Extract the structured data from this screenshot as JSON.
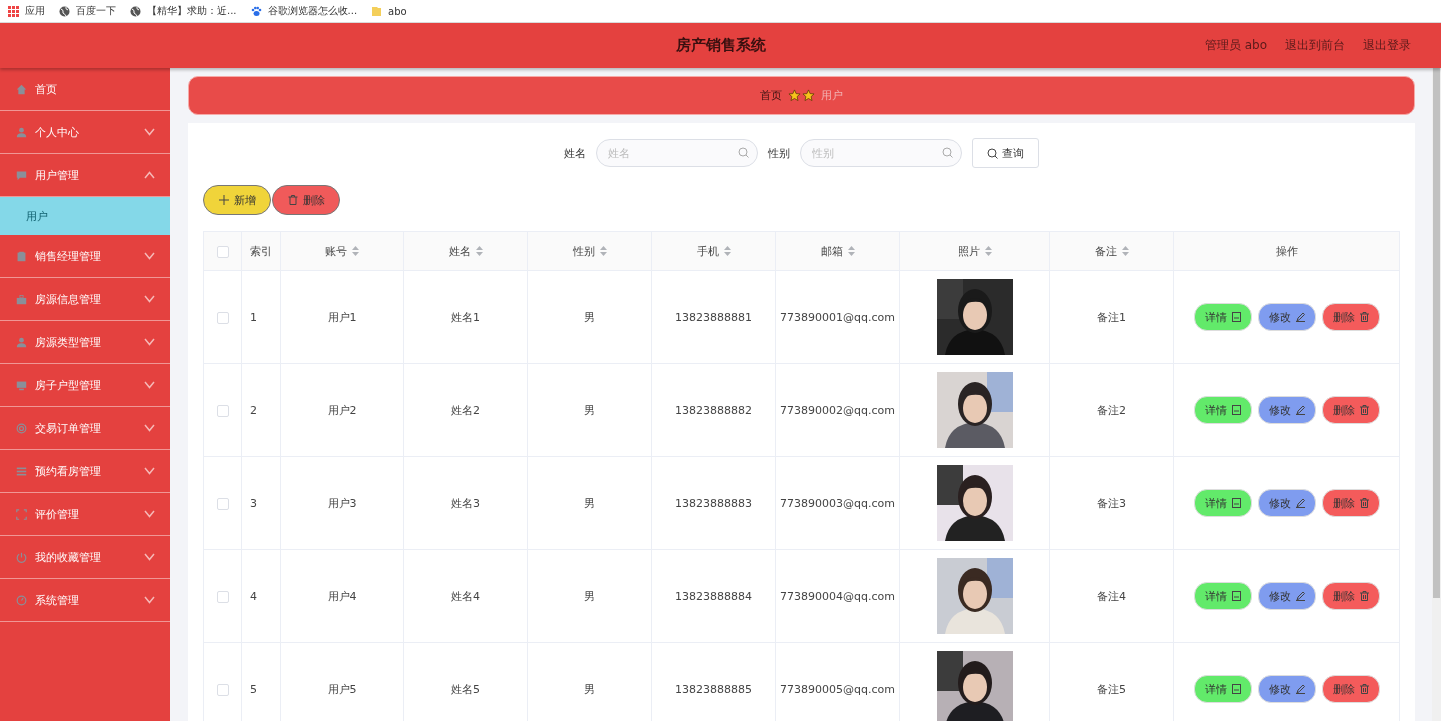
{
  "bookmarks": [
    {
      "kind": "apps",
      "label": "应用"
    },
    {
      "kind": "globe",
      "label": "百度一下"
    },
    {
      "kind": "globe",
      "label": "【精华】求助：近..."
    },
    {
      "kind": "paw",
      "label": "谷歌浏览器怎么收..."
    },
    {
      "kind": "folder",
      "label": "abo"
    }
  ],
  "header": {
    "title": "房产销售系统",
    "links": [
      "管理员 abo",
      "退出到前台",
      "退出登录"
    ]
  },
  "sidebar": {
    "items": [
      {
        "label": "首页",
        "kind": "link"
      },
      {
        "label": "个人中心",
        "kind": "menu",
        "expanded": false
      },
      {
        "label": "用户管理",
        "kind": "menu",
        "expanded": true,
        "children": [
          {
            "label": "用户",
            "selected": true
          }
        ]
      },
      {
        "label": "销售经理管理",
        "kind": "menu",
        "expanded": false
      },
      {
        "label": "房源信息管理",
        "kind": "menu",
        "expanded": false
      },
      {
        "label": "房源类型管理",
        "kind": "menu",
        "expanded": false
      },
      {
        "label": "房子户型管理",
        "kind": "menu",
        "expanded": false
      },
      {
        "label": "交易订单管理",
        "kind": "menu",
        "expanded": false
      },
      {
        "label": "预约看房管理",
        "kind": "menu",
        "expanded": false
      },
      {
        "label": "评价管理",
        "kind": "menu",
        "expanded": false
      },
      {
        "label": "我的收藏管理",
        "kind": "menu",
        "expanded": false
      },
      {
        "label": "系统管理",
        "kind": "menu",
        "expanded": false
      }
    ]
  },
  "breadcrumb": [
    {
      "label": "首页",
      "current": false
    },
    {
      "label": "用户",
      "current": true
    }
  ],
  "search": {
    "fields": [
      {
        "label": "姓名",
        "placeholder": "姓名"
      },
      {
        "label": "性别",
        "placeholder": "性别"
      }
    ],
    "button": "查询"
  },
  "actions": [
    {
      "kind": "add",
      "label": "新增"
    },
    {
      "kind": "delete",
      "label": "删除"
    }
  ],
  "table": {
    "header_checked": false,
    "columns": [
      {
        "label": "索引",
        "sortable": false
      },
      {
        "label": "账号",
        "sortable": true
      },
      {
        "label": "姓名",
        "sortable": true
      },
      {
        "label": "性别",
        "sortable": true
      },
      {
        "label": "手机",
        "sortable": true
      },
      {
        "label": "邮箱",
        "sortable": true
      },
      {
        "label": "照片",
        "sortable": true
      },
      {
        "label": "备注",
        "sortable": true
      },
      {
        "label": "操作",
        "sortable": false
      }
    ],
    "rows": [
      {
        "checked": false,
        "index": "1",
        "account": "用户1",
        "name": "姓名1",
        "gender": "男",
        "phone": "13823888881",
        "email": "773890001@qq.com",
        "note": "备注1",
        "buttons": [
          {
            "kind": "detail",
            "label": "详情"
          },
          {
            "kind": "edit",
            "label": "修改"
          },
          {
            "kind": "delete",
            "label": "删除"
          }
        ]
      },
      {
        "checked": false,
        "index": "2",
        "account": "用户2",
        "name": "姓名2",
        "gender": "男",
        "phone": "13823888882",
        "email": "773890002@qq.com",
        "note": "备注2",
        "buttons": [
          {
            "kind": "detail",
            "label": "详情"
          },
          {
            "kind": "edit",
            "label": "修改"
          },
          {
            "kind": "delete",
            "label": "删除"
          }
        ]
      },
      {
        "checked": false,
        "index": "3",
        "account": "用户3",
        "name": "姓名3",
        "gender": "男",
        "phone": "13823888883",
        "email": "773890003@qq.com",
        "note": "备注3",
        "buttons": [
          {
            "kind": "detail",
            "label": "详情"
          },
          {
            "kind": "edit",
            "label": "修改"
          },
          {
            "kind": "delete",
            "label": "删除"
          }
        ]
      },
      {
        "checked": false,
        "index": "4",
        "account": "用户4",
        "name": "姓名4",
        "gender": "男",
        "phone": "13823888884",
        "email": "773890004@qq.com",
        "note": "备注4",
        "buttons": [
          {
            "kind": "detail",
            "label": "详情"
          },
          {
            "kind": "edit",
            "label": "修改"
          },
          {
            "kind": "delete",
            "label": "删除"
          }
        ]
      },
      {
        "checked": false,
        "index": "5",
        "account": "用户5",
        "name": "姓名5",
        "gender": "男",
        "phone": "13823888885",
        "email": "773890005@qq.com",
        "note": "备注5",
        "buttons": [
          {
            "kind": "detail",
            "label": "详情"
          },
          {
            "kind": "edit",
            "label": "修改"
          },
          {
            "kind": "delete",
            "label": "删除"
          }
        ]
      }
    ]
  }
}
